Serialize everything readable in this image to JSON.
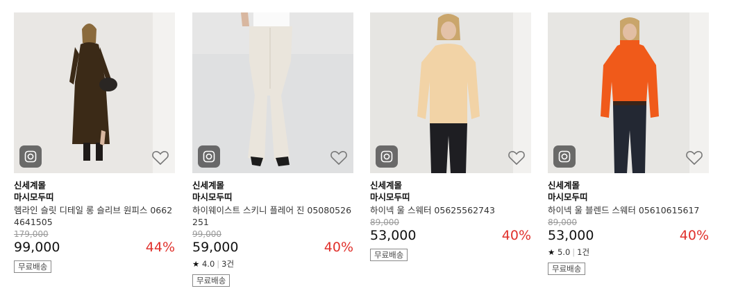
{
  "products": [
    {
      "tag": "신세계몰",
      "brand": "마시모두띠",
      "name": "헴라인 슬릿 디테일 롱 슬리브 원피스 06624641505",
      "original_price": "179,000",
      "price": "99,000",
      "discount": "44%",
      "rating": null,
      "badge": "무료배송",
      "accent_color": "#3b2a17"
    },
    {
      "tag": "신세계몰",
      "brand": "마시모두띠",
      "name": "하이웨이스트 스키니 플레어 진 05080526251",
      "original_price": "99,000",
      "price": "59,000",
      "discount": "40%",
      "rating": {
        "star": "★",
        "score": "4.0",
        "count": "3건"
      },
      "badge": "무료배송",
      "accent_color": "#eae5dc"
    },
    {
      "tag": "신세계몰",
      "brand": "마시모두띠",
      "name": "하이넥 울 스웨터 05625562743",
      "original_price": "89,000",
      "price": "53,000",
      "discount": "40%",
      "rating": null,
      "badge": "무료배송",
      "accent_color": "#f2d3a6"
    },
    {
      "tag": "신세계몰",
      "brand": "마시모두띠",
      "name": "하이넥 울 블렌드 스웨터 05610615617",
      "original_price": "89,000",
      "price": "53,000",
      "discount": "40%",
      "rating": {
        "star": "★",
        "score": "5.0",
        "count": "1건"
      },
      "badge": "무료배송",
      "accent_color": "#f05a1a"
    }
  ],
  "colors": {
    "discount": "#e0302b",
    "background_thumb": "#f4f3f1"
  },
  "icons": {
    "instagram": "instagram-icon",
    "wishlist": "heart-icon"
  }
}
